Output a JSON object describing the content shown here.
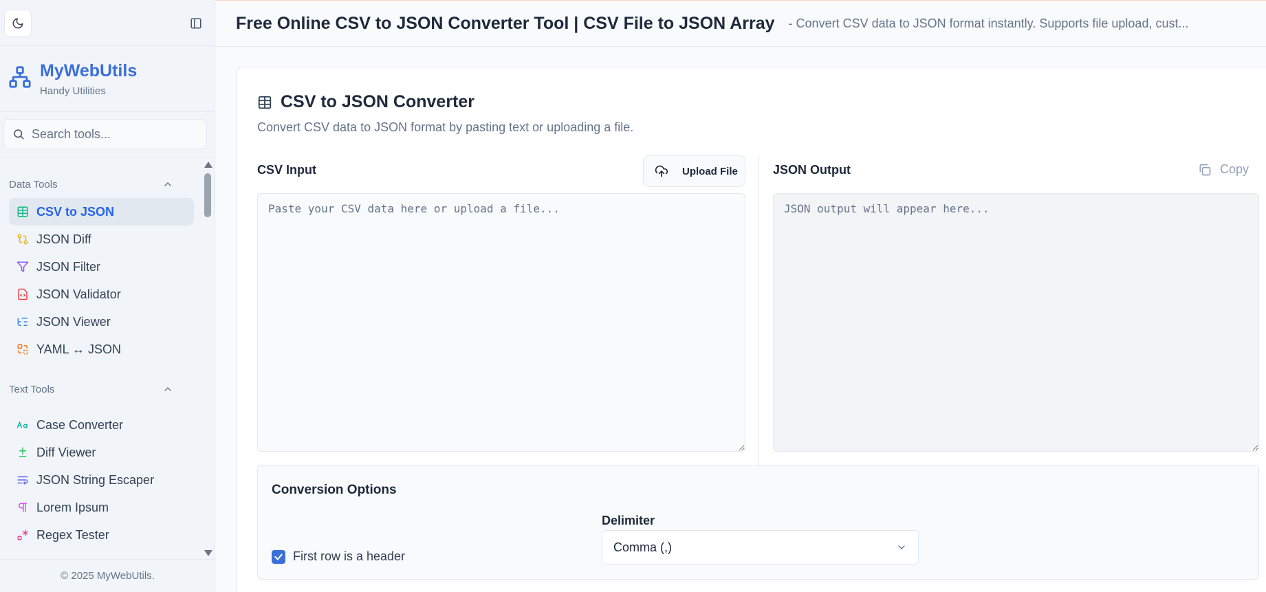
{
  "sidebar": {
    "brand": {
      "name": "MyWebUtils",
      "tagline": "Handy Utilities"
    },
    "search": {
      "placeholder": "Search tools..."
    },
    "groups": [
      {
        "title": "Data Tools",
        "items": [
          {
            "label": "CSV to JSON",
            "icon": "table-icon",
            "color": "#10b981",
            "active": true
          },
          {
            "label": "JSON Diff",
            "icon": "git-compare-icon",
            "color": "#eab308"
          },
          {
            "label": "JSON Filter",
            "icon": "filter-icon",
            "color": "#8b5cf6"
          },
          {
            "label": "JSON Validator",
            "icon": "file-code-icon",
            "color": "#ef4444"
          },
          {
            "label": "JSON Viewer",
            "icon": "list-tree-icon",
            "color": "#3b82f6"
          },
          {
            "label": "YAML ↔ JSON",
            "icon": "convert-icon",
            "color": "#f97316"
          }
        ]
      },
      {
        "title": "Text Tools",
        "items": [
          {
            "label": "Case Converter",
            "icon": "case-icon",
            "color": "#14b8a6"
          },
          {
            "label": "Diff Viewer",
            "icon": "diff-icon",
            "color": "#22c55e"
          },
          {
            "label": "JSON String Escaper",
            "icon": "wrap-text-icon",
            "color": "#6366f1"
          },
          {
            "label": "Lorem Ipsum",
            "icon": "pilcrow-icon",
            "color": "#d946ef"
          },
          {
            "label": "Regex Tester",
            "icon": "regex-icon",
            "color": "#ec4899"
          }
        ]
      }
    ],
    "footer": "© 2025 MyWebUtils."
  },
  "header": {
    "title": "Free Online CSV to JSON Converter Tool | CSV File to JSON Array",
    "subtitle": "- Convert CSV data to JSON format instantly. Supports file upload, cust..."
  },
  "tool": {
    "title": "CSV to JSON Converter",
    "description": "Convert CSV data to JSON format by pasting text or uploading a file.",
    "input_label": "CSV Input",
    "upload_label": "Upload File",
    "input_placeholder": "Paste your CSV data here or upload a file...",
    "output_label": "JSON Output",
    "copy_label": "Copy",
    "output_placeholder": "JSON output will appear here...",
    "options": {
      "title": "Conversion Options",
      "header_checkbox_label": "First row is a header",
      "header_checked": true,
      "delimiter_label": "Delimiter",
      "delimiter_value": "Comma (,)"
    }
  },
  "colors": {
    "accent": "#3b6fd8",
    "active_text": "#2563eb"
  }
}
